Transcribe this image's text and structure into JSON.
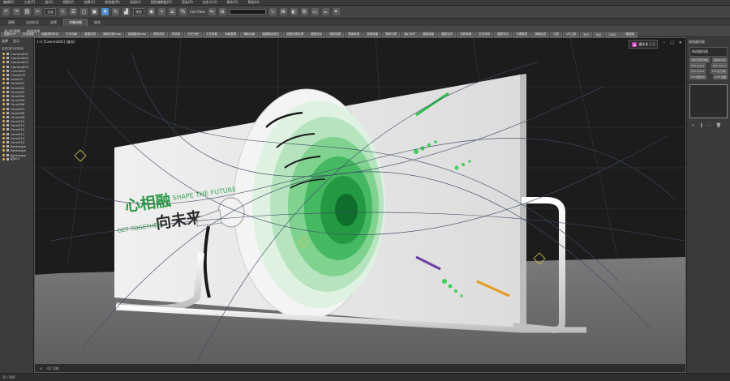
{
  "menubar": {
    "items": [
      "编辑(E)",
      "工具(T)",
      "组(G)",
      "视图(V)",
      "创建(C)",
      "修改器(M)",
      "动画(A)",
      "图形编辑器(D)",
      "渲染(R)",
      "自定义(U)",
      "脚本(S)",
      "帮助(H)"
    ]
  },
  "toolbar": {
    "selection_filter": "全部",
    "view_dropdown": "视图",
    "nav_label": "Cad View"
  },
  "ribbon": {
    "tabs": [
      "建模",
      "自由形式",
      "选择",
      "对象绘制",
      "填充"
    ],
    "active_tab": "对象绘制",
    "panel_labels": [
      "多边形建模",
      "修改选择"
    ],
    "commands": [
      "智能Unit",
      "安全保存",
      "收藏资料导出",
      "灯光场景",
      "重置材质",
      "清除材质map",
      "贴图路径map",
      "资源浏览",
      "材质库",
      "日光分析",
      "灯光参数",
      "场景整理",
      "清除动画",
      "贴图路径修正",
      "贴图资源处理",
      "模型优化",
      "修复贴图",
      "物体检测",
      "资源收集",
      "物体归类",
      "轴心对齐",
      "模型减面",
      "模型合并",
      "材质转换",
      "灯光排布",
      "模型导出",
      "代理模型",
      "场景检查",
      "分层",
      "VR工具",
      "300",
      "500",
      "1000",
      "一键渲染"
    ]
  },
  "scene_explorer": {
    "tabs": [
      "选择",
      "显示"
    ],
    "search_hint": "名称(按升序排序)",
    "items": [
      "Camera001",
      "Camera002",
      "Camera003",
      "Camera004",
      "Circle009",
      "Circle010",
      "Line001",
      "Omni001",
      "Omni002",
      "Omni003",
      "Omni004",
      "Omni005",
      "Omni006",
      "Omni007",
      "Omni008",
      "Omni009",
      "Omni010",
      "Omni011",
      "Omni012",
      "Omni013",
      "Omni014",
      "Omni015",
      "Rectangle",
      "Rectangle",
      "Rectangle",
      "组003"
    ]
  },
  "viewport": {
    "label": "[+] [Camera001] [真实]",
    "badge_text": "横木多 1.3",
    "wall_text": {
      "main_cn": "心相融",
      "main_en": "SHAPE THE FUTURE",
      "sub_cn": "向未来",
      "sub_en": "GET TOGETHER"
    },
    "timeline": "0 / 100"
  },
  "command_panel": {
    "title": "修改器列表",
    "buttons": [
      [
        "对象空间修改器",
        "编辑多边形"
      ],
      [
        "FFD 2x2x2",
        "FFD 3x3x3"
      ],
      [
        "FFD 4x4x4",
        "FFD(长方体)"
      ],
      [
        "FFD(圆柱体)",
        "UVW 贴图"
      ]
    ]
  },
  "colors": {
    "accent": "#4a8fd6",
    "wall": "#e6e6e6",
    "green": "#2fbf4a",
    "floor": "#6b6b6b"
  },
  "icons": [
    "undo-icon",
    "redo-icon",
    "link-icon",
    "unlink-icon",
    "select-icon",
    "move-icon",
    "rotate-icon",
    "scale-icon",
    "snap-icon",
    "render-icon",
    "eye-icon",
    "close-icon"
  ]
}
